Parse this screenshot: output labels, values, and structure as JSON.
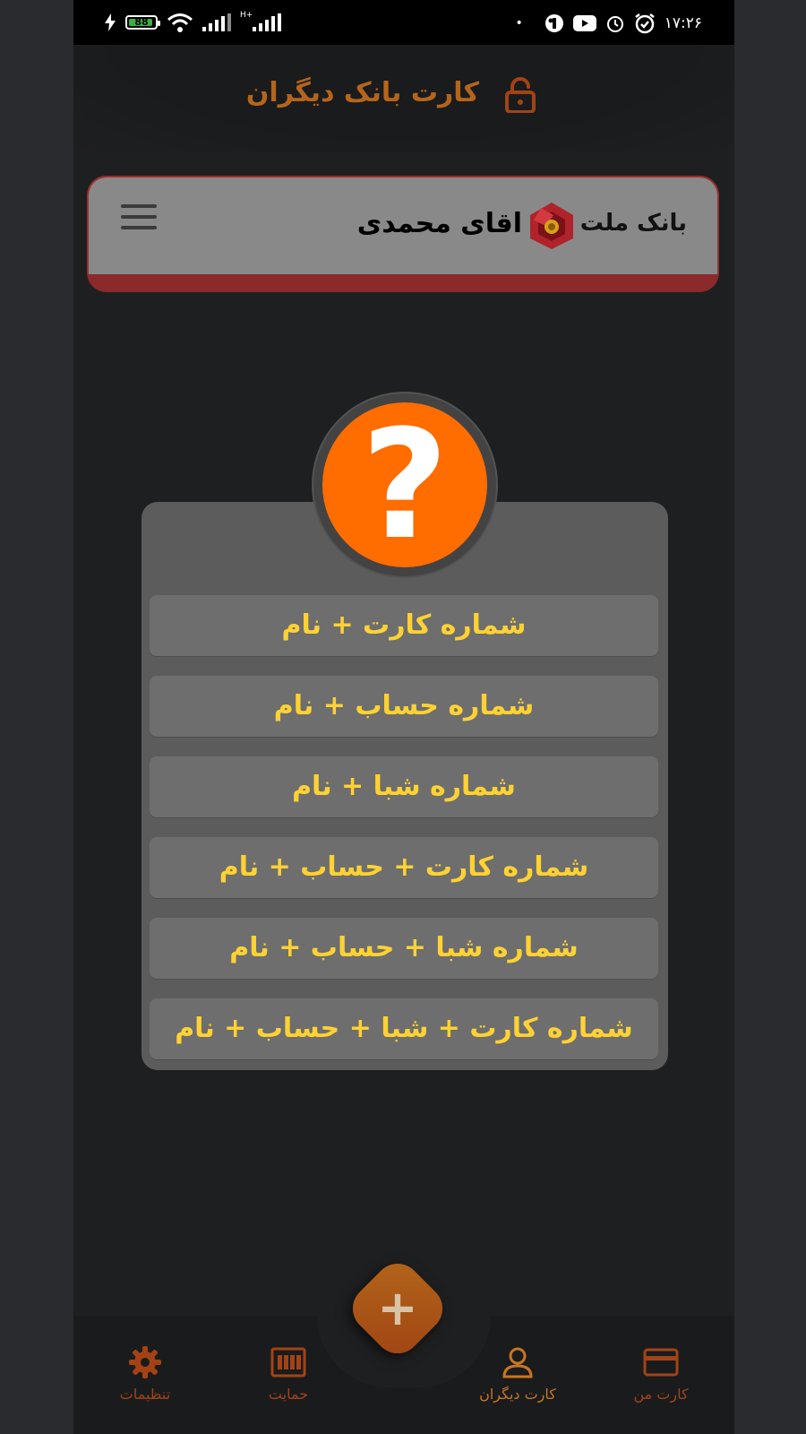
{
  "status_bar": {
    "battery": "88",
    "network": "H+",
    "time": "۱۷:۲۶"
  },
  "header": {
    "title": "کارت بانک دیگران",
    "icon": "lock-open-icon"
  },
  "bank_card": {
    "bank_name": "بانک ملت",
    "owner_name": "اقای محمدی",
    "logo": "bank-mellat-logo",
    "menu_icon": "hamburger-menu-icon"
  },
  "help_dialog": {
    "icon_symbol": "?",
    "options": [
      "شماره کارت + نام",
      "شماره حساب + نام",
      "شماره شبا + نام",
      "شماره کارت + حساب + نام",
      "شماره شبا + حساب + نام",
      "شماره کارت + شبا + حساب + نام"
    ]
  },
  "bottom_nav": {
    "settings": "تنظیمات",
    "support": "حمایت",
    "others_card": "کارت دیگران",
    "my_card": "کارت من",
    "fab": "+"
  },
  "colors": {
    "accent": "#ff6c00",
    "option_text": "#ffd233",
    "header_text": "#b4651b",
    "nav_active": "#c8761f",
    "nav_inactive": "#a34315"
  }
}
